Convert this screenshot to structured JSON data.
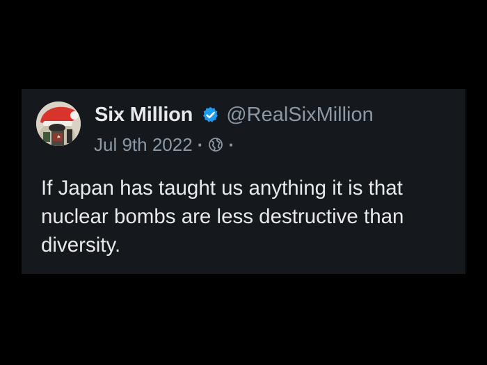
{
  "tweet": {
    "author": {
      "display_name": "Six Million",
      "handle": "@RealSixMillion",
      "verified": true,
      "avatar_icon": "santa-hat-avatar-icon"
    },
    "date": "Jul 9th 2022",
    "separator": "·",
    "visibility_icon": "globe-icon",
    "text": "If Japan has taught us anything it is that nuclear bombs are less destructive than diversity."
  },
  "colors": {
    "page_background": "#000000",
    "card_background": "#15181c",
    "primary_text": "#e7e9ea",
    "secondary_text": "#8b98a5",
    "verified_badge": "#1d9bf0"
  }
}
